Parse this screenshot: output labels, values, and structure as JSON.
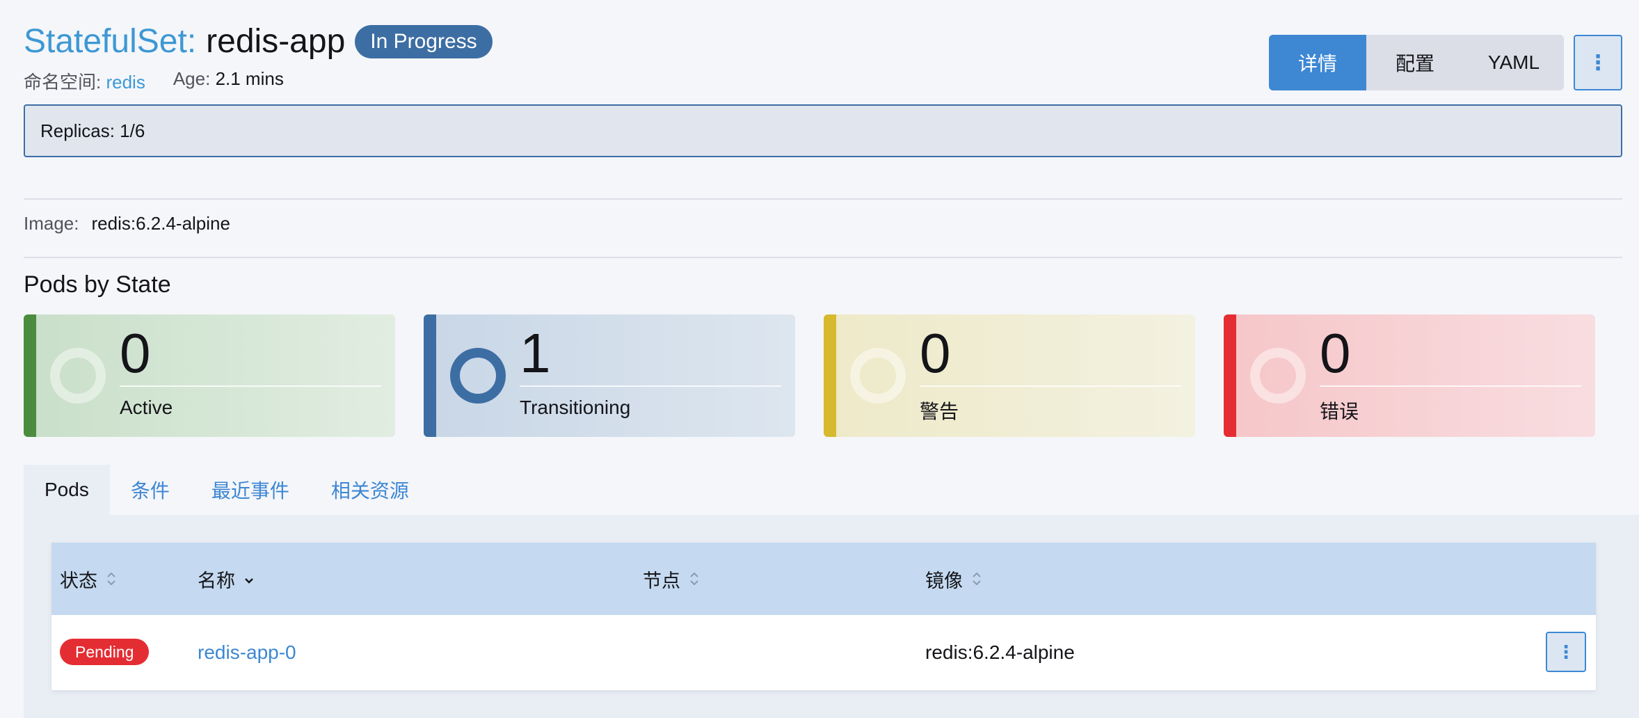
{
  "header": {
    "type_label": "StatefulSet:",
    "name": "redis-app",
    "status_badge": "In Progress",
    "namespace_label": "命名空间:",
    "namespace_value": "redis",
    "age_label": "Age:",
    "age_value": "2.1 mins"
  },
  "view_buttons": {
    "detail": "详情",
    "config": "配置",
    "yaml": "YAML",
    "more": "⋮"
  },
  "replicas": "Replicas: 1/6",
  "image": {
    "label": "Image:",
    "value": "redis:6.2.4-alpine"
  },
  "pods_by_state": {
    "title": "Pods by State",
    "cards": [
      {
        "count": "0",
        "label": "Active"
      },
      {
        "count": "1",
        "label": "Transitioning"
      },
      {
        "count": "0",
        "label": "警告"
      },
      {
        "count": "0",
        "label": "错误"
      }
    ]
  },
  "tabs": [
    "Pods",
    "条件",
    "最近事件",
    "相关资源"
  ],
  "table": {
    "columns": [
      "状态",
      "名称",
      "节点",
      "镜像"
    ],
    "rows": [
      {
        "state": "Pending",
        "name": "redis-app-0",
        "node": "",
        "image": "redis:6.2.4-alpine"
      }
    ],
    "row_action": "⋮"
  },
  "colors": {
    "primary": "#3d87d3",
    "active_bar": "#4b8c3f",
    "transitioning_bar": "#3d6ea3",
    "warning_bar": "#d6b92f",
    "error_bar": "#e42d33",
    "pending_badge": "#e42d33"
  }
}
